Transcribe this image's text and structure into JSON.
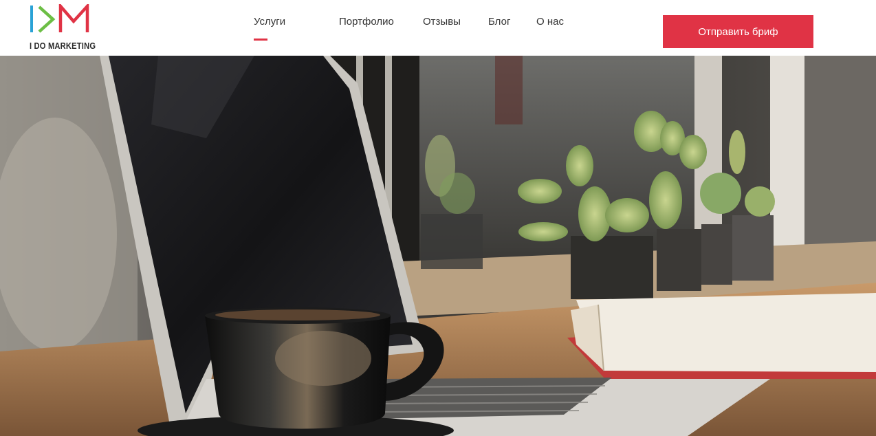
{
  "brand": {
    "name": "I DO MARKETING",
    "colors": {
      "blue": "#2aa2d6",
      "green": "#6cbe45",
      "red": "#e03345"
    }
  },
  "nav": {
    "items": [
      {
        "label": "Услуги",
        "active": true
      },
      {
        "label": "Портфолио",
        "active": false
      },
      {
        "label": "Отзывы",
        "active": false
      },
      {
        "label": "Блог",
        "active": false
      },
      {
        "label": "О нас",
        "active": false
      }
    ]
  },
  "header": {
    "cta_label": "Отправить бриф"
  },
  "hero": {
    "image": "photo-laptop-coffee-cactus",
    "accent_color": "#e03345"
  }
}
